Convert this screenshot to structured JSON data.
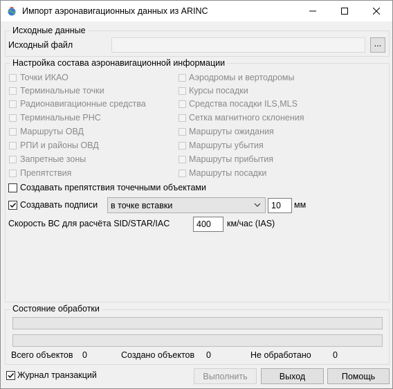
{
  "window": {
    "title": "Импорт аэронавигационных данных из ARINC",
    "icon": "app-icon"
  },
  "source": {
    "group_title": "Исходные данные",
    "file_label": "Исходный файл",
    "file_value": "",
    "browse_label": "..."
  },
  "settings": {
    "group_title": "Настройка состава аэронавигационной информации",
    "left_items": [
      {
        "label": "Точки ИКАО",
        "checked": false,
        "enabled": false
      },
      {
        "label": "Терминальные точки",
        "checked": false,
        "enabled": false
      },
      {
        "label": "Радионавигационные средства",
        "checked": false,
        "enabled": false
      },
      {
        "label": "Терминальные РНС",
        "checked": false,
        "enabled": false
      },
      {
        "label": "Маршруты ОВД",
        "checked": false,
        "enabled": false
      },
      {
        "label": "РПИ и районы ОВД",
        "checked": false,
        "enabled": false
      },
      {
        "label": "Запретные зоны",
        "checked": false,
        "enabled": false
      },
      {
        "label": "Препятствия",
        "checked": false,
        "enabled": false
      }
    ],
    "right_items": [
      {
        "label": "Аэродромы и вертодромы",
        "checked": false,
        "enabled": false
      },
      {
        "label": "Курсы посадки",
        "checked": false,
        "enabled": false
      },
      {
        "label": "Средства посадки ILS,MLS",
        "checked": false,
        "enabled": false
      },
      {
        "label": "Сетка магнитного склонения",
        "checked": false,
        "enabled": false
      },
      {
        "label": "Маршруты ожидания",
        "checked": false,
        "enabled": false
      },
      {
        "label": "Маршруты убытия",
        "checked": false,
        "enabled": false
      },
      {
        "label": "Маршруты прибытия",
        "checked": false,
        "enabled": false
      },
      {
        "label": "Маршруты посадки",
        "checked": false,
        "enabled": false
      }
    ],
    "obstacles_as_points": {
      "label": "Создавать препятствия точечными объектами",
      "checked": false
    },
    "create_labels": {
      "label": "Создавать подписи",
      "checked": true
    },
    "label_position": "в точке вставки",
    "label_size": "10",
    "label_unit": "мм",
    "speed_label": "Скорость ВС для расчёта SID/STAR/IAC",
    "speed_value": "400",
    "speed_unit": "км/час (IAS)"
  },
  "processing": {
    "group_title": "Состояние обработки",
    "progress1": 0,
    "progress2": 0,
    "total_label": "Всего объектов",
    "total_value": "0",
    "created_label": "Создано объектов",
    "created_value": "0",
    "unprocessed_label": "Не обработано",
    "unprocessed_value": "0"
  },
  "footer": {
    "journal_label": "Журнал транзакций",
    "journal_checked": true,
    "run_label": "Выполнить",
    "exit_label": "Выход",
    "help_label": "Помощь"
  }
}
